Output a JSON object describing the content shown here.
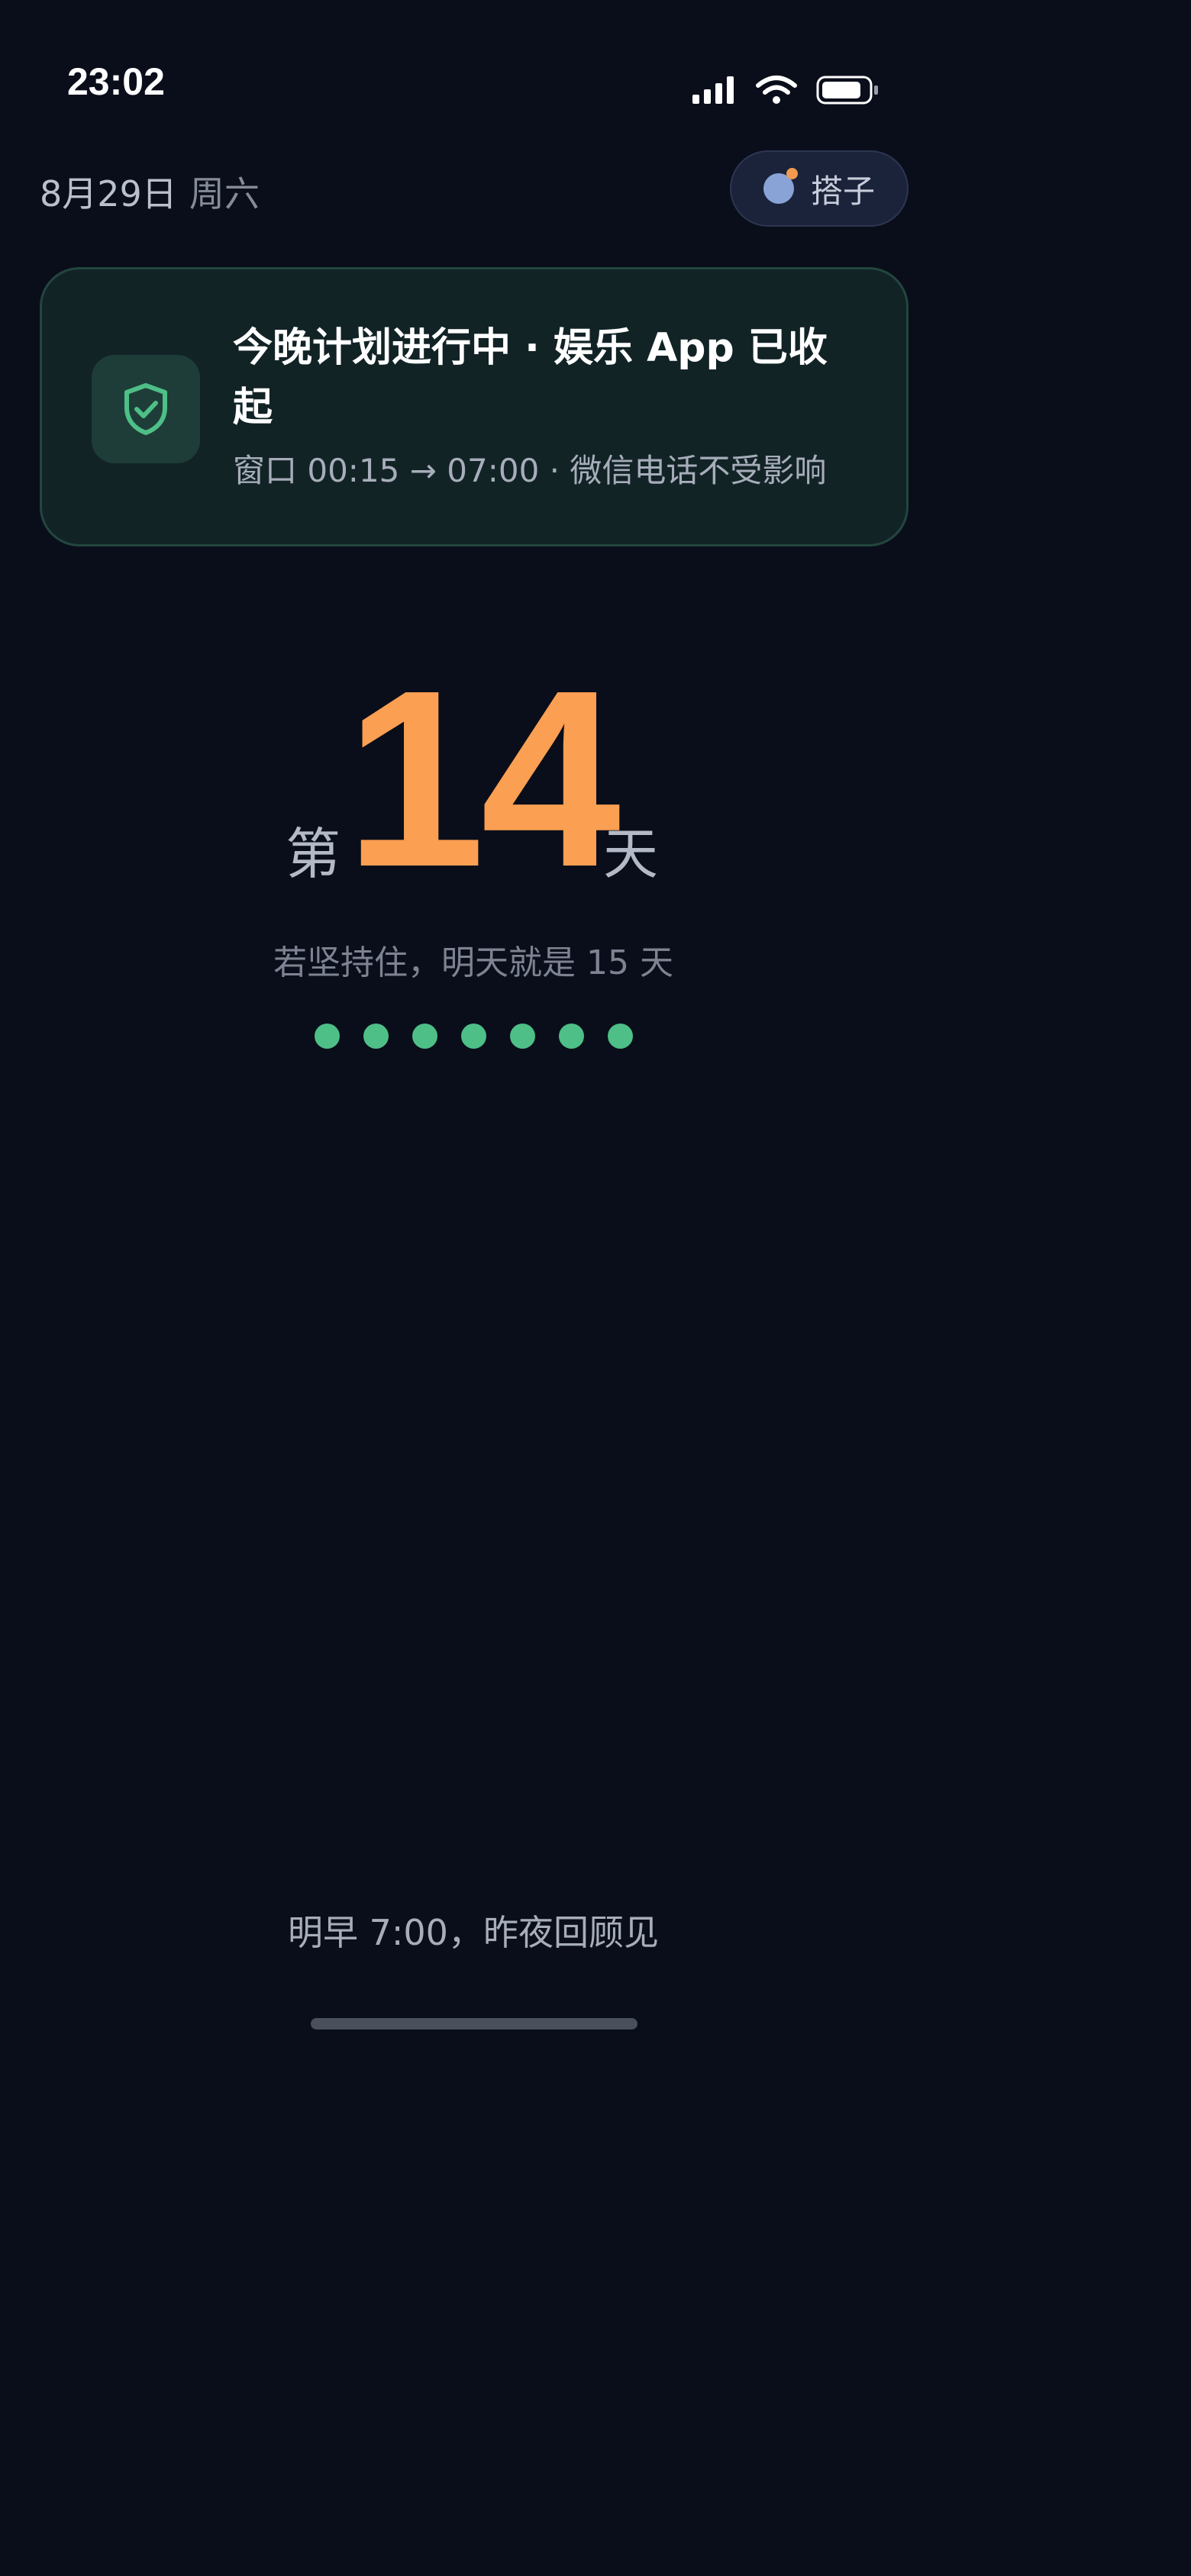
{
  "status_bar": {
    "time": "23:02",
    "icons": [
      "cellular-signal-icon",
      "wifi-icon",
      "battery-icon"
    ]
  },
  "header": {
    "date": "8月29日",
    "weekday": "周六",
    "buddy_button_label": "搭子",
    "buddy_icon": "buddy-avatar-icon"
  },
  "plan_card": {
    "icon": "shield-check-icon",
    "title": "今晚计划进行中 · 娱乐 App 已收起",
    "subtitle": "窗口 00:15 → 07:00 · 微信电话不受影响"
  },
  "streak": {
    "prefix": "第",
    "days": "14",
    "suffix": "天",
    "note": "若坚持住，明天就是 15 天",
    "dots_count": 7
  },
  "footer": {
    "review_hint": "明早 7:00，昨夜回顾见"
  },
  "colors": {
    "background": "#0a0e1a",
    "accent_orange": "#fb9f52",
    "accent_green": "#4dbf87",
    "card_background": "#122326",
    "card_border": "#23463f"
  }
}
